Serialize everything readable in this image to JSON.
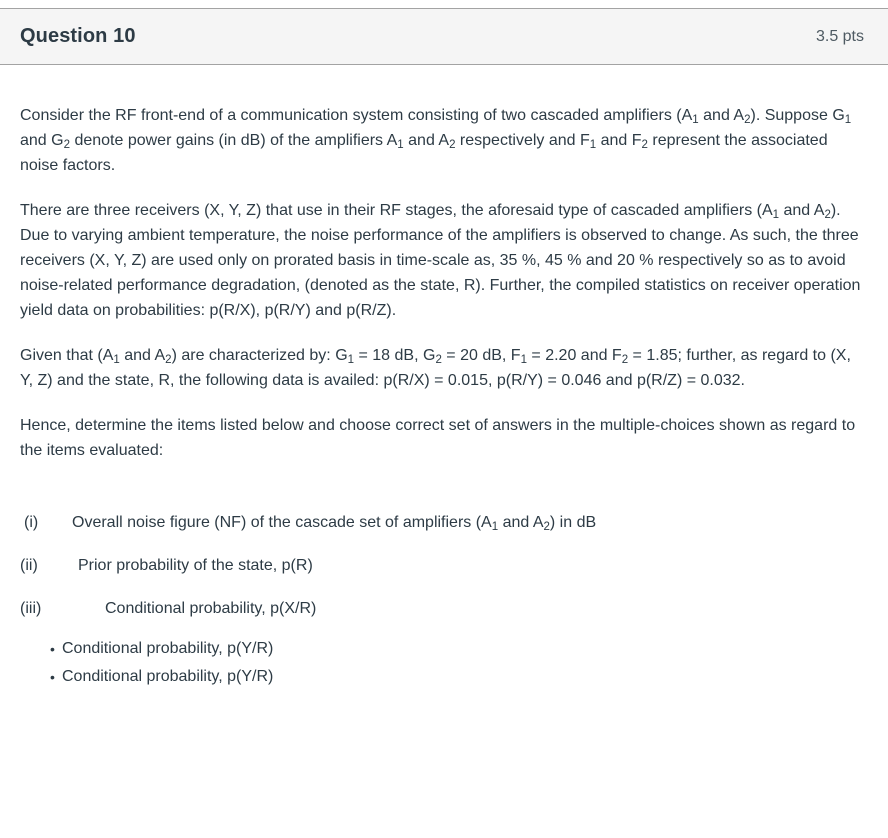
{
  "header": {
    "title": "Question 10",
    "points": "3.5 pts"
  },
  "body": {
    "paragraphs": [
      {
        "id": "p1",
        "segments": [
          {
            "t": "Consider the RF front-end of a communication system consisting of two cascaded amplifiers (A"
          },
          {
            "sub": "1"
          },
          {
            "t": " and A"
          },
          {
            "sub": "2"
          },
          {
            "t": "). Suppose G"
          },
          {
            "sub": "1"
          },
          {
            "t": " and G"
          },
          {
            "sub": "2"
          },
          {
            "t": " denote power gains (in dB) of the amplifiers A"
          },
          {
            "sub": "1"
          },
          {
            "t": " and A"
          },
          {
            "sub": "2"
          },
          {
            "t": " respectively and F"
          },
          {
            "sub": "1"
          },
          {
            "t": " and F"
          },
          {
            "sub": "2"
          },
          {
            "t": " represent the associated noise factors."
          }
        ]
      },
      {
        "id": "p2",
        "segments": [
          {
            "t": "There are three receivers (X, Y, Z) that use in their RF stages, the aforesaid type of cascaded amplifiers (A"
          },
          {
            "sub": "1"
          },
          {
            "t": " and A"
          },
          {
            "sub": "2"
          },
          {
            "t": "). Due to varying ambient temperature, the noise performance of the amplifiers is observed to change. As such, the three receivers (X, Y, Z) are used only on prorated basis in time-scale as, 35 %, 45 % and 20 % respectively so as to avoid noise-related performance degradation, (denoted as the state, R). Further, the compiled statistics on receiver operation yield data on probabilities: p(R/X), p(R/Y) and p(R/Z)."
          }
        ]
      },
      {
        "id": "p3",
        "segments": [
          {
            "t": "Given that (A"
          },
          {
            "sub": "1"
          },
          {
            "t": " and A"
          },
          {
            "sub": "2"
          },
          {
            "t": ") are characterized by: G"
          },
          {
            "sub": "1"
          },
          {
            "t": " = 18 dB, G"
          },
          {
            "sub": "2"
          },
          {
            "t": " = 20 dB, F"
          },
          {
            "sub": "1"
          },
          {
            "t": " = 2.20 and F"
          },
          {
            "sub": "2"
          },
          {
            "t": " = 1.85; further, as regard to (X, Y, Z) and the state, R, the following data is availed: p(R/X) = 0.015, p(R/Y) = 0.046 and p(R/Z) = 0.032."
          }
        ]
      },
      {
        "id": "p4",
        "segments": [
          {
            "t": "Hence, determine the items listed below and choose correct set of answers in the multiple-choices shown as regard to the items evaluated:"
          }
        ]
      }
    ],
    "roman_items": [
      {
        "marker": "(i)",
        "segments": [
          {
            "t": "Overall noise figure (NF) of the cascade set of amplifiers (A"
          },
          {
            "sub": "1"
          },
          {
            "t": " and A"
          },
          {
            "sub": "2"
          },
          {
            "t": ") in dB"
          }
        ]
      },
      {
        "marker": "(ii)",
        "segments": [
          {
            "t": "Prior probability of the state, p(R)"
          }
        ]
      },
      {
        "marker": "(iii)",
        "segments": [
          {
            "t": "Conditional probability, p(X/R)"
          }
        ]
      }
    ],
    "bullets": [
      "Conditional probability, p(Y/R)",
      "Conditional probability, p(Y/R)"
    ]
  },
  "colors": {
    "header_background": "#f5f5f5",
    "header_border": "#a3a3a3",
    "text": "#2d3b45",
    "points_text": "#4e5a62",
    "page_background": "#ffffff"
  }
}
